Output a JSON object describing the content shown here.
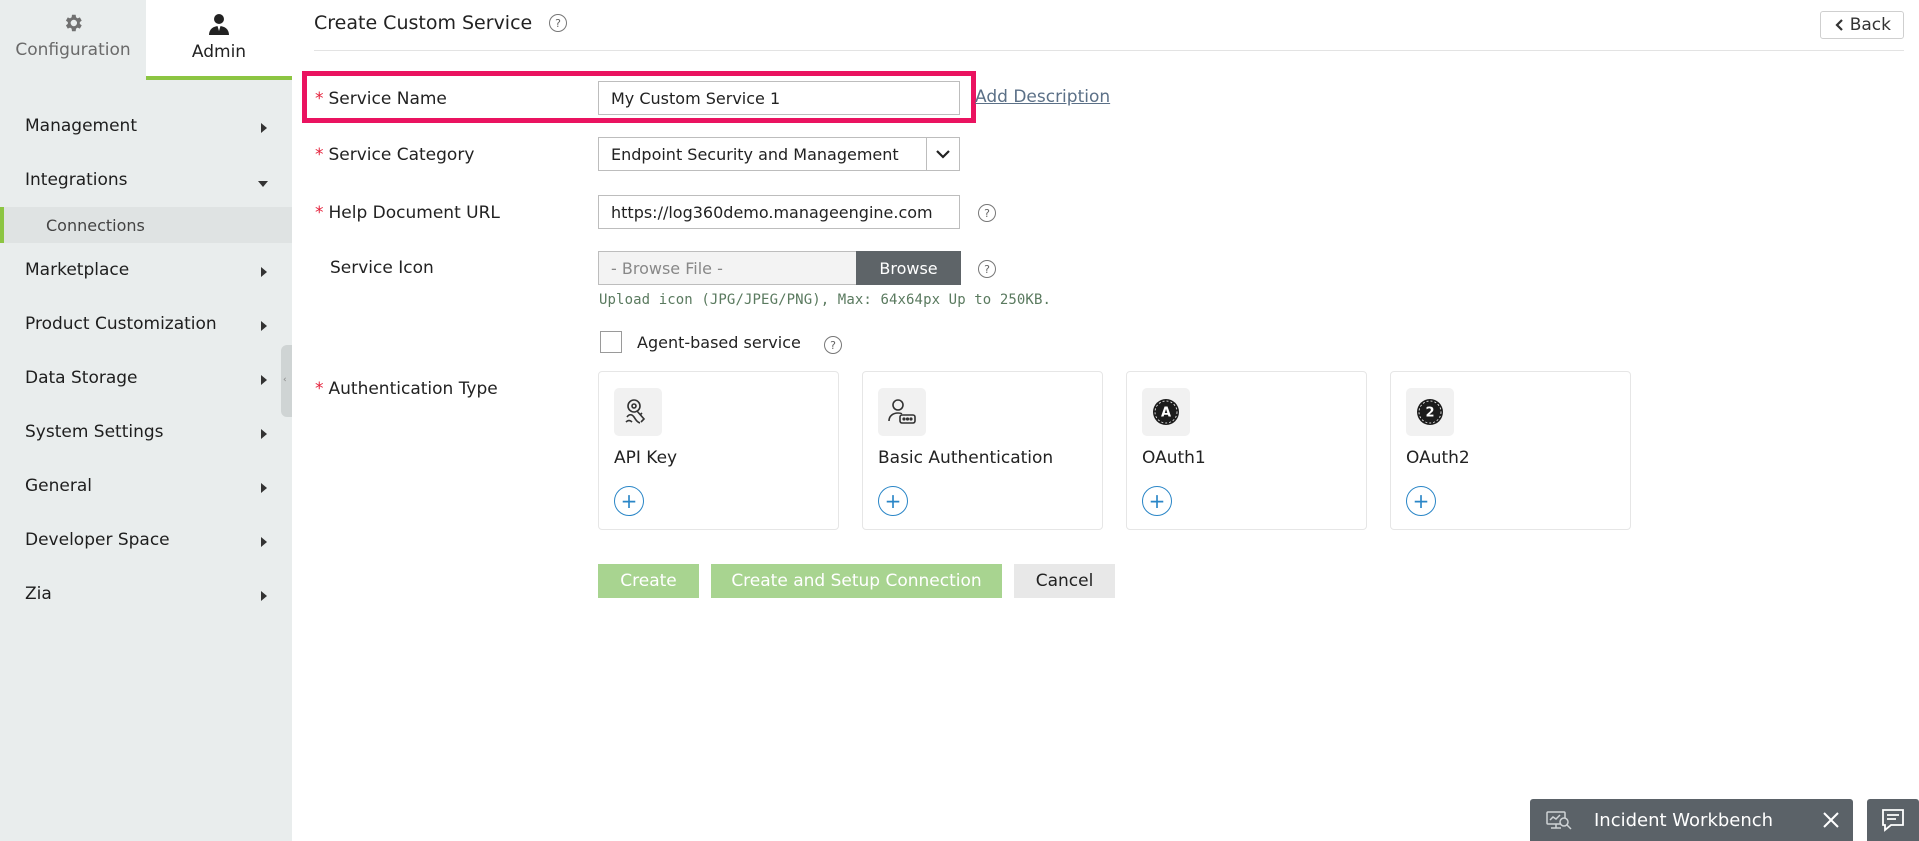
{
  "sidebar": {
    "tabs": {
      "configuration": "Configuration",
      "admin": "Admin"
    },
    "items": [
      {
        "label": "Management"
      },
      {
        "label": "Integrations"
      },
      {
        "label": "Connections"
      },
      {
        "label": "Marketplace"
      },
      {
        "label": "Product Customization"
      },
      {
        "label": "Data Storage"
      },
      {
        "label": "System Settings"
      },
      {
        "label": "General"
      },
      {
        "label": "Developer Space"
      },
      {
        "label": "Zia"
      }
    ],
    "active_item": "Connections"
  },
  "header": {
    "title": "Create Custom Service",
    "help_symbol": "?",
    "back_label": "Back"
  },
  "form": {
    "required_marker": "*",
    "service_name": {
      "label": "Service Name",
      "value": "My Custom Service 1",
      "add_description": "Add Description"
    },
    "service_category": {
      "label": "Service Category",
      "value": "Endpoint Security and Management"
    },
    "help_document_url": {
      "label": "Help Document URL",
      "value": "https://log360demo.manageengine.com"
    },
    "service_icon": {
      "label": "Service Icon",
      "placeholder": "- Browse File -",
      "browse_label": "Browse",
      "hint": "Upload icon (JPG/JPEG/PNG), Max: 64x64px Up to 250KB."
    },
    "agent_based": {
      "label": "Agent-based service",
      "checked": false
    },
    "authentication_type": {
      "label": "Authentication Type",
      "options": [
        {
          "name": "API Key",
          "icon": "key-fingerprint-icon"
        },
        {
          "name": "Basic Authentication",
          "icon": "user-password-icon"
        },
        {
          "name": "OAuth1",
          "icon": "oauth1-icon"
        },
        {
          "name": "OAuth2",
          "icon": "oauth2-icon"
        }
      ],
      "oauth1_glyph": "A",
      "oauth2_glyph": "2",
      "add_symbol": "+"
    },
    "buttons": {
      "create": "Create",
      "create_setup": "Create and Setup Connection",
      "cancel": "Cancel"
    }
  },
  "widgets": {
    "incident_workbench": "Incident Workbench"
  },
  "colors": {
    "accent_green": "#8cc542",
    "highlight": "#ea1360",
    "required": "#e4213b",
    "link": "#5b7087",
    "add_blue": "#2a86c7"
  }
}
